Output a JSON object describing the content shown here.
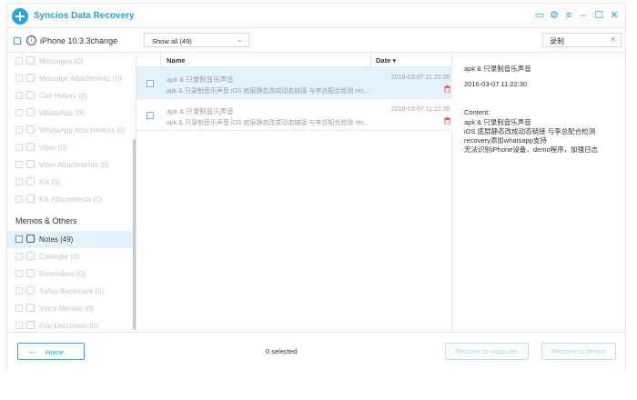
{
  "app": {
    "title": "Syncios Data Recovery"
  },
  "window_controls": [
    {
      "name": "feedback-icon",
      "glyph": "▭"
    },
    {
      "name": "settings-icon",
      "glyph": "⚙"
    },
    {
      "name": "menu-icon",
      "glyph": "≡"
    },
    {
      "name": "minimize-icon",
      "glyph": "–"
    },
    {
      "name": "maximize-icon",
      "glyph": "☐"
    },
    {
      "name": "close-icon",
      "glyph": "✕"
    }
  ],
  "device": {
    "name": "iPhone 10.3.3change",
    "icon_glyph": "ⓘ"
  },
  "sidebar": {
    "section_header": "Memos & Others",
    "items": [
      {
        "label": "Messages (0)",
        "icon": "message-icon",
        "active": false
      },
      {
        "label": "Message Attachments (0)",
        "icon": "attachment-icon",
        "active": false
      },
      {
        "label": "Call History (0)",
        "icon": "phone-icon",
        "active": false
      },
      {
        "label": "WhatsApp (0)",
        "icon": "whatsapp-icon",
        "active": false
      },
      {
        "label": "WhatsApp Attachments (0)",
        "icon": "attachment-icon",
        "active": false
      },
      {
        "label": "Viber (0)",
        "icon": "viber-icon",
        "active": false
      },
      {
        "label": "Viber Attachments (0)",
        "icon": "attachment-icon",
        "active": false
      },
      {
        "label": "Kik (0)",
        "icon": "kik-icon",
        "active": false
      },
      {
        "label": "Kik Attachments (0)",
        "icon": "attachment-icon",
        "active": false
      },
      {
        "label": "Notes (49)",
        "icon": "notes-icon",
        "active": true
      },
      {
        "label": "Calendar (0)",
        "icon": "calendar-icon",
        "active": false
      },
      {
        "label": "Reminders (0)",
        "icon": "reminder-icon",
        "active": false
      },
      {
        "label": "Safari Bookmark (0)",
        "icon": "bookmark-icon",
        "active": false
      },
      {
        "label": "Voice Memos (0)",
        "icon": "microphone-icon",
        "active": false
      },
      {
        "label": "App Document (0)",
        "icon": "document-icon",
        "active": false
      }
    ]
  },
  "toolbar": {
    "filter_value": "Show all (49)",
    "search_value": "录制"
  },
  "list": {
    "columns": {
      "name": "Name",
      "date": "Date ▾"
    },
    "rows": [
      {
        "title": "apk & 只录制音乐声音",
        "subtitle": "apk & 只录制音乐声音 iOS 底层静态改成动态链接 与李总配合检测 rec...",
        "date": "2016-03-07 11:22:30",
        "selected": true
      },
      {
        "title": "apk & 只录制音乐声音",
        "subtitle": "apk & 只录制音乐声音 iOS 底层静态改成动态链接 与李总配合检测 rec...",
        "date": "2016-03-07 11:22:30",
        "selected": false
      }
    ]
  },
  "detail": {
    "title": "apk & 只录制音乐声音",
    "date": "2016-03-07 11:22:30",
    "content_label": "Content:",
    "content_lines": [
      "apk & 只录制音乐声音",
      "iOS 底层静态改成动态链接 与李总配合检测",
      "recovery添加whatsapp支持",
      "无法识别iPhone设备，demo程序，加强日志"
    ]
  },
  "footer": {
    "home_label": "Home",
    "home_arrow": "←",
    "selected_text": "0 selected",
    "recover_computer": "Recover to computer",
    "recover_device": "Recover to device"
  },
  "colors": {
    "accent": "#2d9de0",
    "selected_row": "#e4f2fb",
    "trash": "#e0504a"
  }
}
